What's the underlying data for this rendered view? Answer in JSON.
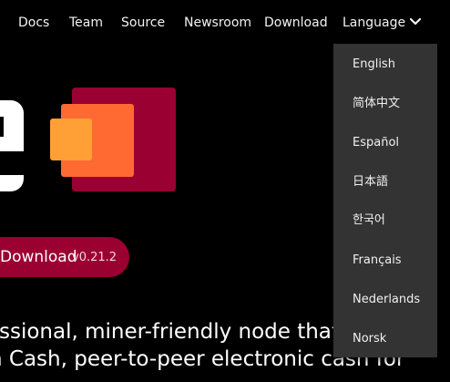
{
  "nav": {
    "links": [
      "Docs",
      "Team",
      "Source",
      "Newsroom",
      "Download"
    ],
    "language_label": "Language"
  },
  "hero": {
    "download_label": "Download",
    "version": "v0.21.2",
    "tagline_line1": "ssional, miner-friendly node that",
    "tagline_line2": "n Cash, peer-to-peer electronic cash for"
  },
  "language_menu": {
    "items": [
      "English",
      "简体中文",
      "Español",
      "日本語",
      "한국어",
      "Français",
      "Nederlands",
      "Norsk"
    ]
  },
  "colors": {
    "background": "#000000",
    "menu_background": "#333333",
    "brand_crimson": "#9b0032",
    "logo_orange": "#ff6a32",
    "logo_light_orange": "#ffa036"
  },
  "icons": {
    "language_toggle": "chevron-down-icon"
  }
}
